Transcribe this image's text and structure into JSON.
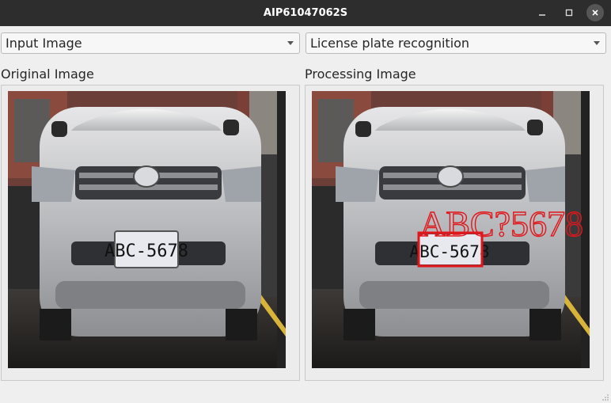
{
  "window": {
    "title": "AIP61047062S"
  },
  "controls": {
    "source_select": {
      "value": "Input Image"
    },
    "mode_select": {
      "value": "License plate recognition"
    }
  },
  "panels": {
    "original": {
      "label": "Original Image"
    },
    "processing": {
      "label": "Processing Image"
    }
  },
  "plate": {
    "text": "ABC-5678",
    "recognized_text": "ABC?5678"
  },
  "colors": {
    "titlebar": "#2d2d2d",
    "detection_box": "#e0161b",
    "recognized_text": "#e0161b"
  },
  "icons": {
    "minimize": "minimize-icon",
    "maximize": "maximize-icon",
    "close": "close-icon",
    "dropdown": "chevron-down-icon"
  }
}
